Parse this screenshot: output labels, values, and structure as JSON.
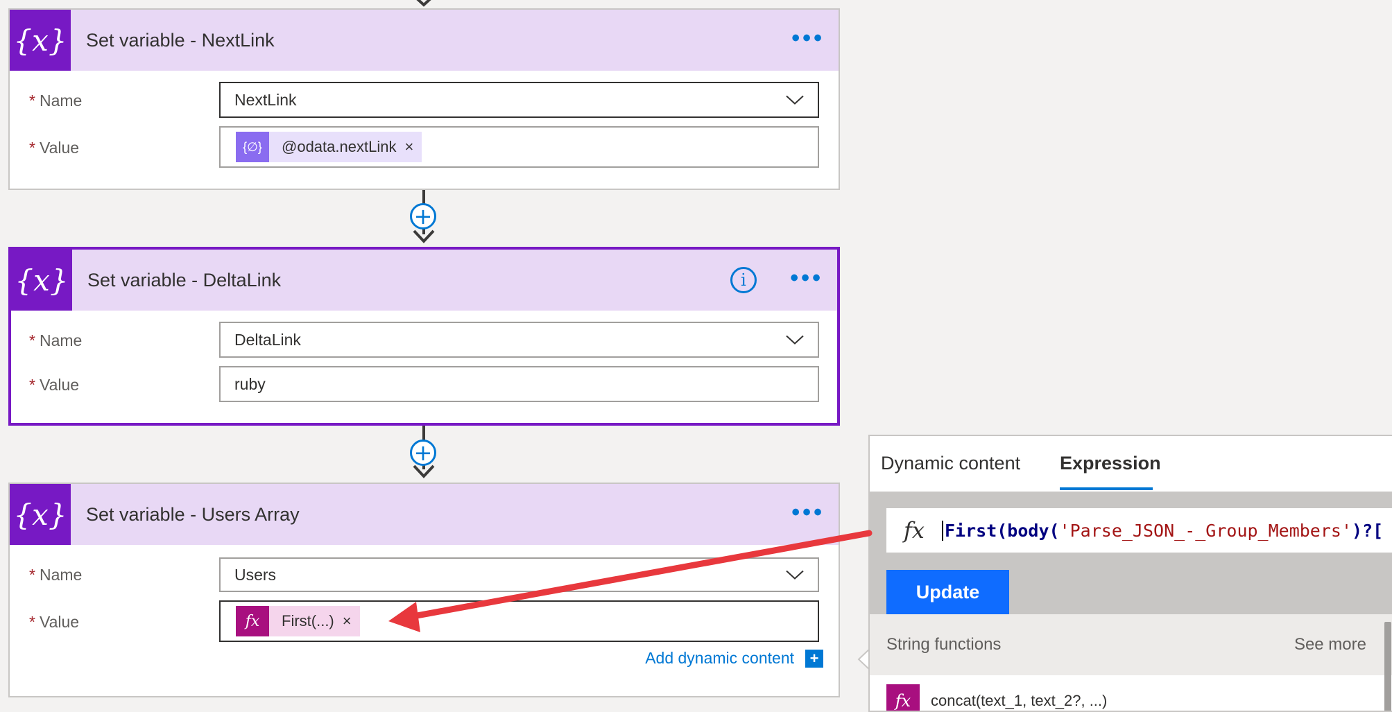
{
  "steps": [
    {
      "title": "Set variable - NextLink",
      "icon": "{x}",
      "fields": [
        {
          "label": "Name",
          "required": "*",
          "value": "NextLink"
        },
        {
          "label": "Value",
          "required": "*",
          "token": {
            "label": "@odata.nextLink",
            "icon": "{∅}",
            "close": "×"
          }
        }
      ]
    },
    {
      "title": "Set variable - DeltaLink",
      "icon": "{x}",
      "info_icon": "i",
      "fields": [
        {
          "label": "Name",
          "required": "*",
          "value": "DeltaLink"
        },
        {
          "label": "Value",
          "required": "*",
          "value": "ruby"
        }
      ]
    },
    {
      "title": "Set variable - Users Array",
      "icon": "{x}",
      "fields": [
        {
          "label": "Name",
          "required": "*",
          "value": "Users"
        },
        {
          "label": "Value",
          "required": "*",
          "token": {
            "label": "First(...)",
            "icon": "fx",
            "close": "×"
          }
        }
      ],
      "add_dynamic_content": "Add dynamic content",
      "add_icon": "+"
    }
  ],
  "more_menu": "•••",
  "insert_step": "+",
  "expression_panel": {
    "tabs": [
      "Dynamic content",
      "Expression"
    ],
    "active_tab": "Expression",
    "fx": "fx",
    "expression_fn": "First(body(",
    "expression_arg": "'Parse_JSON_-_Group_Members'",
    "expression_rest": ")?[",
    "update_label": "Update",
    "section_title": "String functions",
    "see_more": "See more",
    "functions": [
      {
        "name": "concat(text_1, text_2?, ...)",
        "icon": "fx"
      }
    ]
  },
  "colors": {
    "accent": "#0078d4",
    "variable_purple": "#7719c4",
    "header_lavender": "#e8d8f5",
    "expression_magenta": "#a80f7f",
    "annotation_red": "#e8383d"
  },
  "annotation": "red arrow from expression box to First(...) token"
}
